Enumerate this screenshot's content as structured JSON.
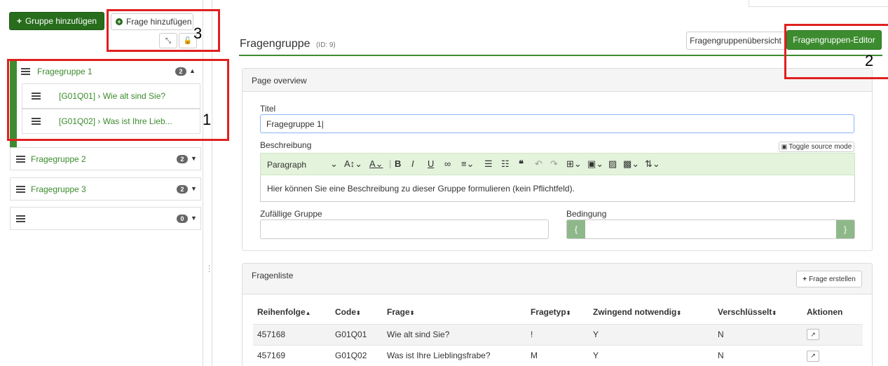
{
  "sidebar": {
    "add_group_label": "Gruppe hinzufügen",
    "add_question_label": "Frage hinzufügen",
    "groups": [
      {
        "label": "Fragegruppe 1",
        "count": "2",
        "expanded": true,
        "questions": [
          {
            "label": "[G01Q01] › Wie alt sind Sie?"
          },
          {
            "label": "[G01Q02] › Was ist Ihre Lieb..."
          }
        ]
      },
      {
        "label": "Fragegruppe 2",
        "count": "2"
      },
      {
        "label": "Fragegruppe 3",
        "count": "2"
      },
      {
        "label": "",
        "count": "0"
      }
    ]
  },
  "header": {
    "title": "Fragengruppe",
    "id_text": "(ID: 9)",
    "overview_button": "Fragengruppenübersicht",
    "editor_button": "Fragengruppen-Editor"
  },
  "overview": {
    "heading": "Page overview",
    "title_label": "Titel",
    "title_value": "Fragegruppe 1|",
    "description_label": "Beschreibung",
    "toggle_source": "Toggle source mode",
    "paragraph_select": "Paragraph",
    "description_text": "Hier können Sie eine Beschreibung zu dieser Gruppe formulieren (kein Pflichtfeld).",
    "random_group_label": "Zufällige Gruppe",
    "condition_label": "Bedingung",
    "brace_open": "{",
    "brace_close": "}"
  },
  "question_list": {
    "heading": "Fragenliste",
    "create_button": "Frage erstellen",
    "columns": [
      "Reihenfolge",
      "Code",
      "Frage",
      "Fragetyp",
      "Zwingend notwendig",
      "Verschlüsselt",
      "Aktionen"
    ],
    "rows": [
      [
        "457168",
        "G01Q01",
        "Wie alt sind Sie?",
        "!",
        "Y",
        "N"
      ],
      [
        "457169",
        "G01Q02",
        "Was ist Ihre Lieblingsfrabe?",
        "M",
        "Y",
        "N"
      ]
    ]
  },
  "annotations": {
    "marker_1": "1",
    "marker_2": "2",
    "marker_3": "3"
  },
  "colors": {
    "accent_green": "#3c8c2f",
    "dark_green": "#276d1c",
    "annotation_red": "#e02020"
  }
}
